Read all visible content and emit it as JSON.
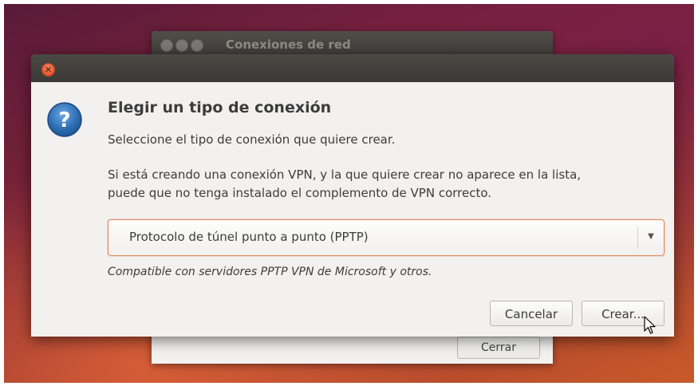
{
  "background_window": {
    "title": "Conexiones de red",
    "close_label": "Cerrar"
  },
  "dialog": {
    "heading": "Elegir un tipo de conexión",
    "subtext": "Seleccione el tipo de conexión que quiere crear.",
    "info_line1": "Si está creando una conexión VPN, y la que quiere crear no aparece en la lista,",
    "info_line2": "puede que no tenga instalado el complemento de VPN correcto.",
    "connection_type_selected": "Protocolo de túnel punto a punto (PPTP)",
    "compat_note": "Compatible con servidores PPTP VPN de Microsoft y otros.",
    "cancel_label": "Cancelar",
    "create_label": "Crear..."
  },
  "icons": {
    "dialog_close": "close-icon",
    "dialog_type": "question-icon",
    "dropdown": "chevron-down-icon",
    "pointer": "mouse-cursor-icon"
  },
  "colors": {
    "close_button": "#e0502a",
    "focus_border": "#e28a5f",
    "question_icon": "#2f6fb4",
    "titlebar": "#3c3b37"
  }
}
